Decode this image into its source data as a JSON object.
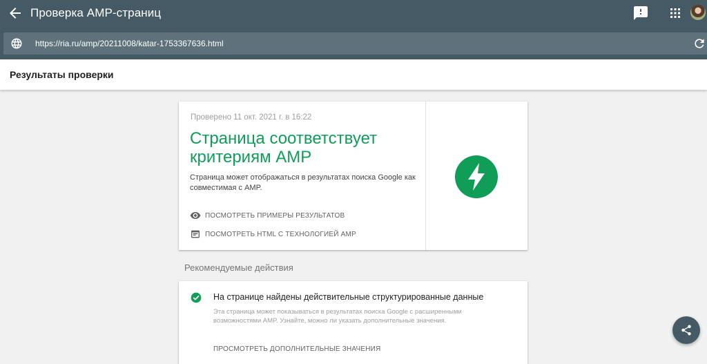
{
  "app": {
    "title": "Проверка AMP-страниц"
  },
  "url_bar": {
    "value": "https://ria.ru/amp/20211008/katar-1753367636.html"
  },
  "subheader": {
    "title": "Результаты проверки"
  },
  "result": {
    "checked_time": "Проверено 11 окт. 2021 г. в 16:22",
    "headline": "Страница соответствует критериям AMP",
    "description": "Страница может отображаться в результатах поиска Google как совместимая с AMP.",
    "actions": [
      {
        "label": "ПОСМОТРЕТЬ ПРИМЕРЫ РЕЗУЛЬТАТОВ",
        "icon": "eye-icon"
      },
      {
        "label": "ПОСМОТРЕТЬ HTML С ТЕХНОЛОГИЕЙ AMP",
        "icon": "code-window-icon"
      }
    ],
    "status_color": "#0f9d58"
  },
  "recommended": {
    "section_title": "Рекомендуемые действия",
    "items": [
      {
        "title": "На странице найдены действительные структурированные данные",
        "description": "Эта страница может показываться в результатах поиска Google с расширенными возможностями AMP. Узнайте, можно ли указать дополнительные значения.",
        "link": "ПРОСМОТРЕТЬ ДОПОЛНИТЕЛЬНЫЕ ЗНАЧЕНИЯ",
        "icon": "check-circle-icon"
      }
    ]
  },
  "colors": {
    "header": "#455a64",
    "url_bar": "#5f727b",
    "accent_green": "#0f9d58"
  }
}
